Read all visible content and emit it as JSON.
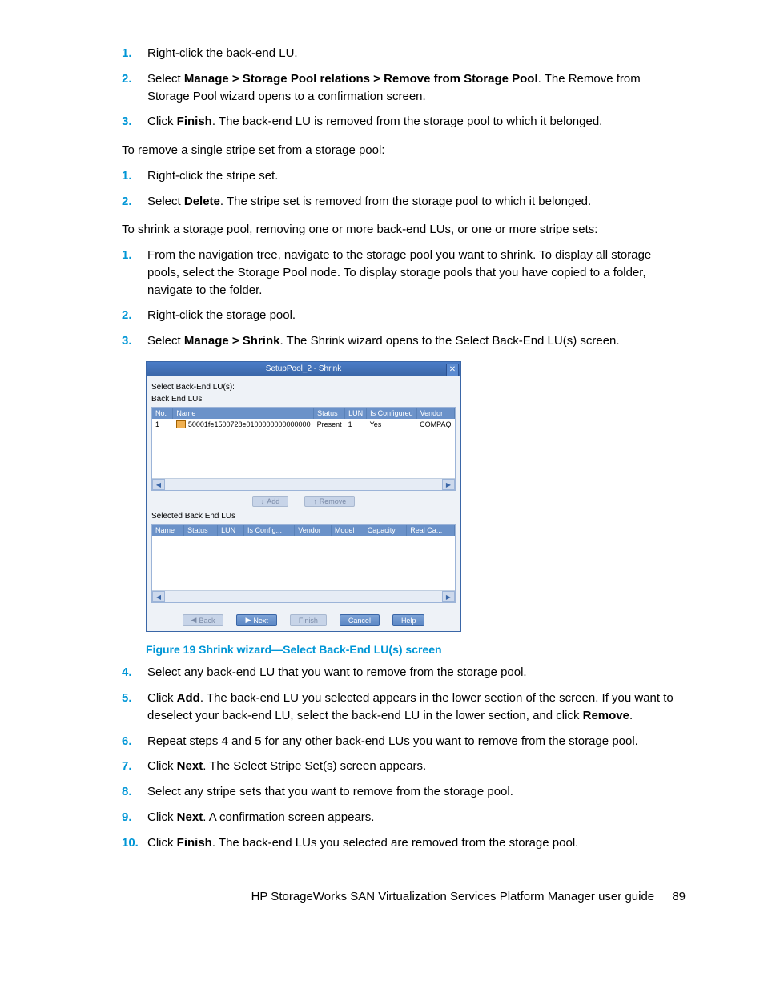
{
  "list1": {
    "items": [
      {
        "n": "1.",
        "text": "Right-click the back-end LU."
      },
      {
        "n": "2.",
        "text_before": "Select ",
        "bold": "Manage > Storage Pool relations > Remove from Storage Pool",
        "text_after": ". The Remove from Storage Pool wizard opens to a confirmation screen."
      },
      {
        "n": "3.",
        "text_before": "Click ",
        "bold": "Finish",
        "text_after": ". The back-end LU is removed from the storage pool to which it belonged."
      }
    ]
  },
  "para1": "To remove a single stripe set from a storage pool:",
  "list2": {
    "items": [
      {
        "n": "1.",
        "text": "Right-click the stripe set."
      },
      {
        "n": "2.",
        "text_before": "Select ",
        "bold": "Delete",
        "text_after": ". The stripe set is removed from the storage pool to which it belonged."
      }
    ]
  },
  "para2": "To shrink a storage pool, removing one or more back-end LUs, or one or more stripe sets:",
  "list3a": {
    "items": [
      {
        "n": "1.",
        "text": "From the navigation tree, navigate to the storage pool you want to shrink. To display all storage pools, select the Storage Pool node. To display storage pools that you have copied to a folder, navigate to the folder."
      },
      {
        "n": "2.",
        "text": "Right-click the storage pool."
      },
      {
        "n": "3.",
        "text_before": "Select ",
        "bold": "Manage > Shrink",
        "text_after": ". The Shrink wizard opens to the Select Back-End LU(s) screen."
      }
    ]
  },
  "dialog": {
    "title": "SetupPool_2 - Shrink",
    "select_label": "Select Back-End LU(s):",
    "section1": "Back End LUs",
    "table1": {
      "headers": [
        "No.",
        "Name",
        "Status",
        "LUN",
        "Is Configured",
        "Vendor"
      ],
      "row": {
        "no": "1",
        "name": "50001fe1500728e0100000000000000",
        "status": "Present",
        "lun": "1",
        "cfg": "Yes",
        "vendor": "COMPAQ"
      }
    },
    "add_btn": "Add",
    "remove_btn": "Remove",
    "section2": "Selected Back End LUs",
    "table2": {
      "headers": [
        "Name",
        "Status",
        "LUN",
        "Is Config...",
        "Vendor",
        "Model",
        "Capacity",
        "Real Ca..."
      ]
    },
    "nav": {
      "back": "Back",
      "next": "Next",
      "finish": "Finish",
      "cancel": "Cancel",
      "help": "Help"
    }
  },
  "figure_caption": "Figure 19 Shrink wizard—Select Back-End LU(s) screen",
  "list3b": {
    "items": [
      {
        "n": "4.",
        "text": "Select any back-end LU that you want to remove from the storage pool."
      },
      {
        "n": "5.",
        "text_before": "Click ",
        "bold": "Add",
        "text_mid": ". The back-end LU you selected appears in the lower section of the screen. If you want to deselect your back-end LU, select the back-end LU in the lower section, and click ",
        "bold2": "Remove",
        "text_after": "."
      },
      {
        "n": "6.",
        "text": "Repeat steps 4 and 5 for any other back-end LUs you want to remove from the storage pool."
      },
      {
        "n": "7.",
        "text_before": "Click ",
        "bold": "Next",
        "text_after": ". The Select Stripe Set(s) screen appears."
      },
      {
        "n": "8.",
        "text": "Select any stripe sets that you want to remove from the storage pool."
      },
      {
        "n": "9.",
        "text_before": "Click ",
        "bold": "Next",
        "text_after": ". A confirmation screen appears."
      },
      {
        "n": "10.",
        "text_before": "Click ",
        "bold": "Finish",
        "text_after": ". The back-end LUs you selected are removed from the storage pool."
      }
    ]
  },
  "footer": {
    "text": "HP StorageWorks SAN Virtualization Services Platform Manager user guide",
    "page": "89"
  }
}
